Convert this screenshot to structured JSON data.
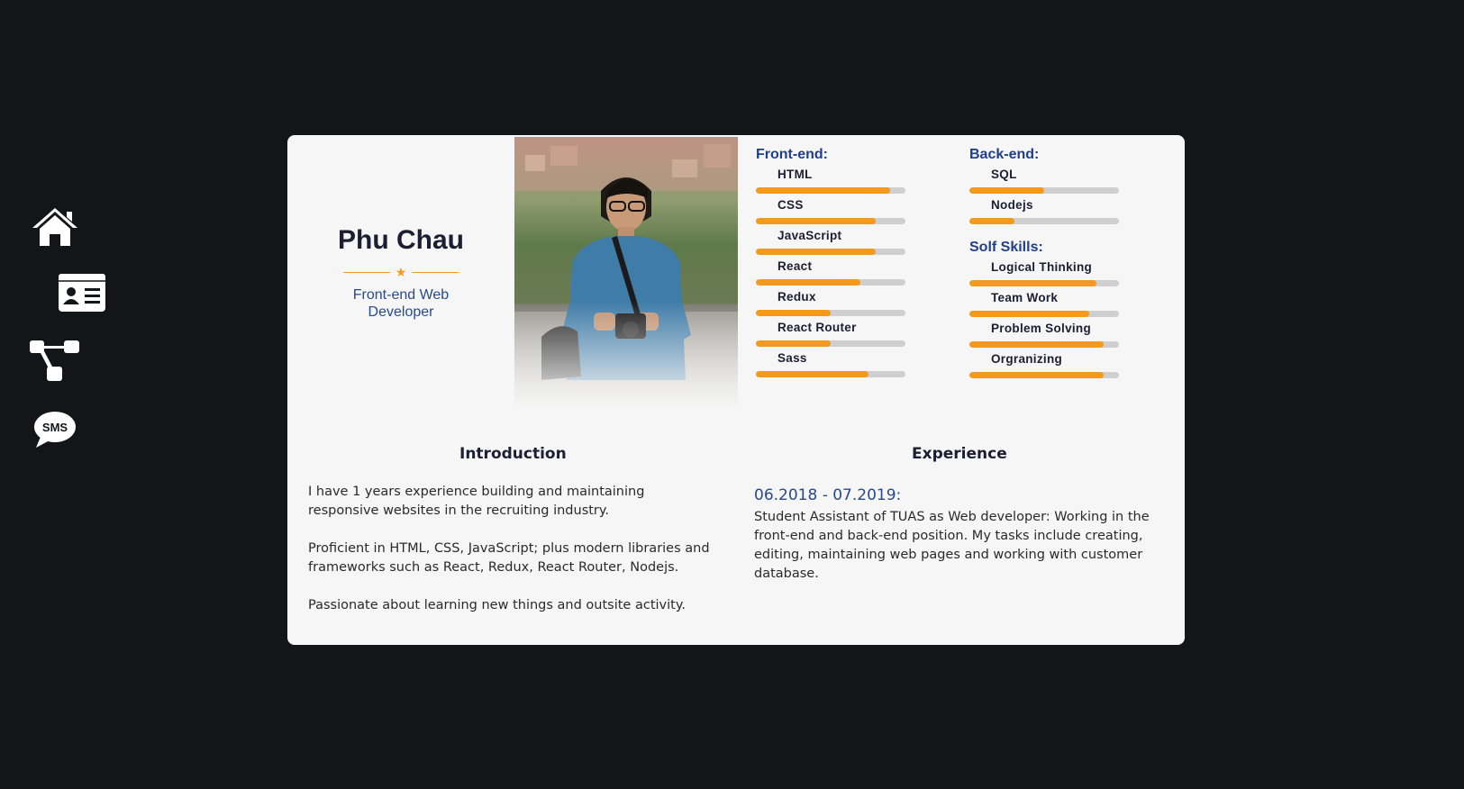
{
  "nav": {
    "items": [
      {
        "icon": "home-icon"
      },
      {
        "icon": "id-card-icon"
      },
      {
        "icon": "sitemap-icon"
      },
      {
        "icon": "sms-icon",
        "label": "SMS"
      }
    ]
  },
  "profile": {
    "name": "Phu Chau",
    "role": "Front-end Web Developer"
  },
  "skills": {
    "frontend": {
      "title": "Front-end:",
      "items": [
        {
          "label": "HTML",
          "level": 0.9
        },
        {
          "label": "CSS",
          "level": 0.8
        },
        {
          "label": "JavaScript",
          "level": 0.8
        },
        {
          "label": "React",
          "level": 0.7
        },
        {
          "label": "Redux",
          "level": 0.5
        },
        {
          "label": "React Router",
          "level": 0.5
        },
        {
          "label": "Sass",
          "level": 0.75
        }
      ]
    },
    "backend": {
      "title": "Back-end:",
      "items": [
        {
          "label": "SQL",
          "level": 0.5
        },
        {
          "label": "Nodejs",
          "level": 0.3
        }
      ]
    },
    "soft": {
      "title": "Solf Skills:",
      "items": [
        {
          "label": "Logical Thinking",
          "level": 0.85
        },
        {
          "label": "Team Work",
          "level": 0.8
        },
        {
          "label": "Problem Solving",
          "level": 0.9
        },
        {
          "label": "Orgranizing",
          "level": 0.9
        }
      ]
    }
  },
  "introduction": {
    "title": "Introduction",
    "paragraphs": [
      "I have 1 years experience building and maintaining responsive websites in the recruiting industry.",
      "Proficient in HTML, CSS, JavaScript; plus modern libraries and frameworks such as React, Redux, React Router, Nodejs.",
      "Passionate about learning new things and outsite activity."
    ]
  },
  "experience": {
    "title": "Experience",
    "date": "06.2018 - 07.2019:",
    "description": "Student Assistant of TUAS as Web developer: Working in the front-end and back-end position. My tasks include creating, editing, maintaining web pages and working with customer database."
  },
  "colors": {
    "background": "#141519",
    "card": "#f6f6f6",
    "accent": "#f39a1c",
    "heading_blue": "#1f3e8c",
    "text_blue": "#274a8c"
  }
}
